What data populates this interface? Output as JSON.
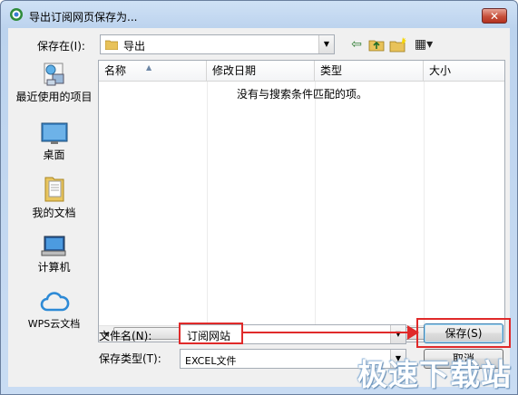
{
  "window": {
    "title": "导出订阅网页保存为...",
    "close_label": "✕"
  },
  "save_in": {
    "label": "保存在(I):",
    "value": "导出"
  },
  "toolbar": {
    "back_icon": "⇦",
    "up_icon": "up-folder-icon",
    "new_folder_icon": "new-folder-icon",
    "view_menu_icon": "▦▾"
  },
  "places": [
    {
      "label": "最近使用的项目",
      "icon": "recent-items-icon"
    },
    {
      "label": "桌面",
      "icon": "desktop-icon"
    },
    {
      "label": "我的文档",
      "icon": "documents-icon"
    },
    {
      "label": "计算机",
      "icon": "computer-icon"
    },
    {
      "label": "WPS云文档",
      "icon": "cloud-icon"
    }
  ],
  "file_list": {
    "columns": [
      "名称",
      "修改日期",
      "类型",
      "大小"
    ],
    "empty_message": "没有与搜索条件匹配的项。"
  },
  "file_name": {
    "label": "文件名(N):",
    "value": "订阅网站"
  },
  "file_type": {
    "label": "保存类型(T):",
    "value": "EXCEL文件"
  },
  "buttons": {
    "save": "保存(S)",
    "cancel": "取消"
  },
  "watermark": "极速下载站",
  "annotation_color": "#e02a2a"
}
